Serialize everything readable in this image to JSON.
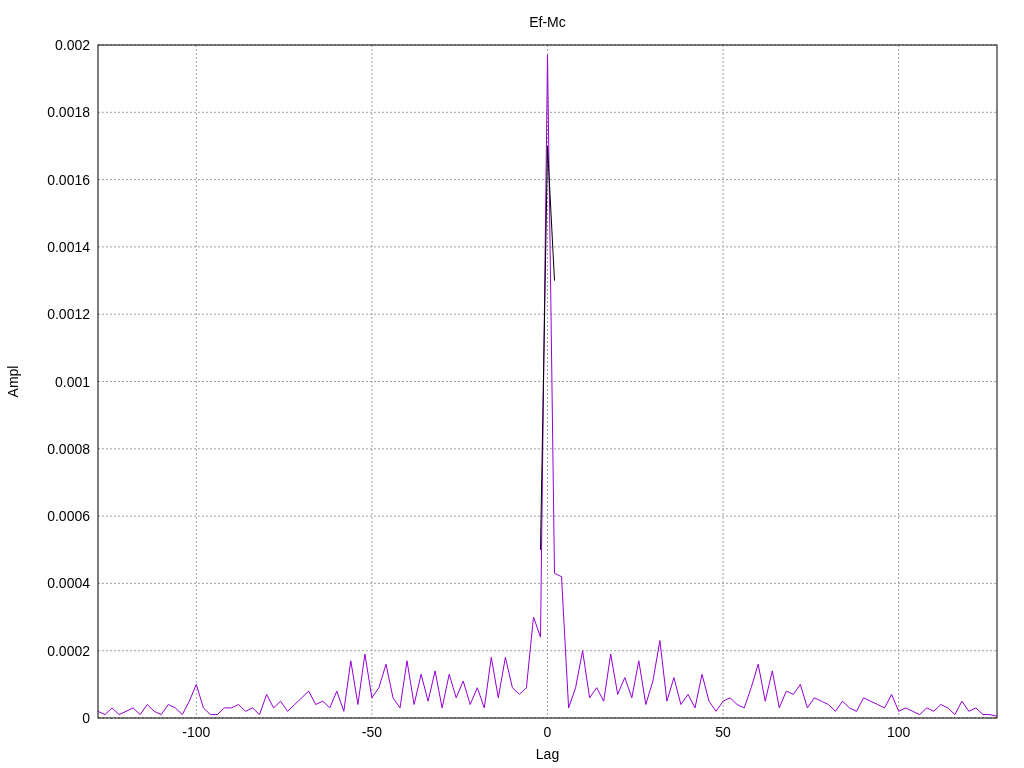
{
  "chart_data": {
    "type": "line",
    "title": "Ef-Mc",
    "xlabel": "Lag",
    "ylabel": "Ampl",
    "x": [
      -128,
      -126,
      -124,
      -122,
      -120,
      -118,
      -116,
      -114,
      -112,
      -110,
      -108,
      -106,
      -104,
      -102,
      -100,
      -98,
      -96,
      -94,
      -92,
      -90,
      -88,
      -86,
      -84,
      -82,
      -80,
      -78,
      -76,
      -74,
      -72,
      -70,
      -68,
      -66,
      -64,
      -62,
      -60,
      -58,
      -56,
      -54,
      -52,
      -50,
      -48,
      -46,
      -44,
      -42,
      -40,
      -38,
      -36,
      -34,
      -32,
      -30,
      -28,
      -26,
      -24,
      -22,
      -20,
      -18,
      -16,
      -14,
      -12,
      -10,
      -8,
      -6,
      -4,
      -2,
      0,
      2,
      4,
      6,
      8,
      10,
      12,
      14,
      16,
      18,
      20,
      22,
      24,
      26,
      28,
      30,
      32,
      34,
      36,
      38,
      40,
      42,
      44,
      46,
      48,
      50,
      52,
      54,
      56,
      58,
      60,
      62,
      64,
      66,
      68,
      70,
      72,
      74,
      76,
      78,
      80,
      82,
      84,
      86,
      88,
      90,
      92,
      94,
      96,
      98,
      100,
      102,
      104,
      106,
      108,
      110,
      112,
      114,
      116,
      118,
      120,
      122,
      124,
      126,
      128
    ],
    "series": [
      {
        "color": "#9400d3",
        "values": [
          2e-05,
          1e-05,
          3e-05,
          1e-05,
          2e-05,
          3e-05,
          1e-05,
          4e-05,
          2e-05,
          1e-05,
          4e-05,
          3e-05,
          1e-05,
          5e-05,
          0.0001,
          3e-05,
          1e-05,
          1e-05,
          3e-05,
          3e-05,
          4e-05,
          2e-05,
          3e-05,
          1e-05,
          7e-05,
          3e-05,
          5e-05,
          2e-05,
          4e-05,
          6e-05,
          8e-05,
          4e-05,
          5e-05,
          3e-05,
          8e-05,
          2e-05,
          0.00017,
          4e-05,
          0.00019,
          6e-05,
          9e-05,
          0.00016,
          6e-05,
          3e-05,
          0.00017,
          4e-05,
          0.00013,
          5e-05,
          0.00014,
          3e-05,
          0.00013,
          6e-05,
          0.00011,
          4e-05,
          9e-05,
          3e-05,
          0.00018,
          6e-05,
          0.00018,
          9e-05,
          7e-05,
          9e-05,
          0.0003,
          0.00024,
          0.00197,
          0.00043,
          0.00042,
          3e-05,
          9e-05,
          0.0002,
          6e-05,
          9e-05,
          5e-05,
          0.00019,
          7e-05,
          0.00012,
          6e-05,
          0.00017,
          4e-05,
          0.00011,
          0.00023,
          5e-05,
          0.00012,
          4e-05,
          7e-05,
          3e-05,
          0.00013,
          5e-05,
          2e-05,
          5e-05,
          6e-05,
          4e-05,
          3e-05,
          9e-05,
          0.00016,
          5e-05,
          0.00014,
          3e-05,
          8e-05,
          7e-05,
          0.0001,
          3e-05,
          6e-05,
          5e-05,
          4e-05,
          2e-05,
          5e-05,
          3e-05,
          2e-05,
          6e-05,
          5e-05,
          4e-05,
          3e-05,
          7e-05,
          2e-05,
          3e-05,
          2e-05,
          1e-05,
          3e-05,
          2e-05,
          4e-05,
          3e-05,
          1e-05,
          5e-05,
          2e-05,
          3e-05,
          1e-05,
          1e-05,
          5e-06
        ]
      },
      {
        "color": "#000000",
        "values": [
          null,
          null,
          null,
          null,
          null,
          null,
          null,
          null,
          null,
          null,
          null,
          null,
          null,
          null,
          null,
          null,
          null,
          null,
          null,
          null,
          null,
          null,
          null,
          null,
          null,
          null,
          null,
          null,
          null,
          null,
          null,
          null,
          null,
          null,
          null,
          null,
          null,
          null,
          null,
          null,
          null,
          null,
          null,
          null,
          null,
          null,
          null,
          null,
          null,
          null,
          null,
          null,
          null,
          null,
          null,
          null,
          null,
          null,
          null,
          null,
          null,
          null,
          null,
          0.0005,
          0.0017,
          0.0013,
          null,
          null,
          null,
          null,
          null,
          null,
          null,
          null,
          null,
          null,
          null,
          null,
          null,
          null,
          null,
          null,
          null,
          null,
          null,
          null,
          null,
          null,
          null,
          null,
          null,
          null,
          null,
          null,
          null,
          null,
          null,
          null,
          null,
          null,
          null,
          null,
          null,
          null,
          null,
          null,
          null,
          null,
          null,
          null,
          null,
          null,
          null,
          null,
          null,
          null,
          null,
          null,
          null,
          null,
          null,
          null,
          null,
          null,
          null,
          null,
          null,
          null,
          null
        ]
      }
    ],
    "grid": true,
    "xlim": [
      -128,
      128
    ],
    "ylim": [
      0,
      0.002
    ],
    "xticks": [
      -100,
      -50,
      0,
      50,
      100
    ],
    "yticks": [
      0,
      0.0002,
      0.0004,
      0.0006,
      0.0008,
      0.001,
      0.0012,
      0.0014,
      0.0016,
      0.0018,
      0.002
    ]
  }
}
